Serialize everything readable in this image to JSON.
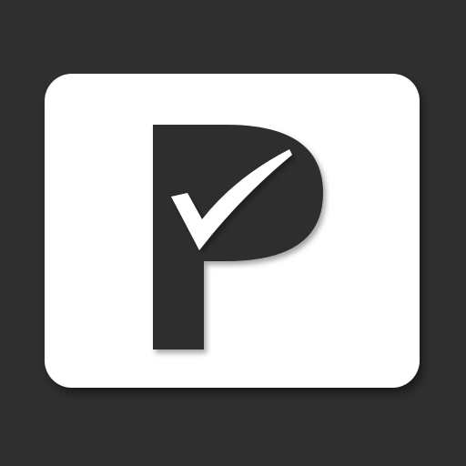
{
  "app_icon": {
    "background_color": "#2f2f2f",
    "card_color": "#ffffff",
    "glyph_color": "#2f2f2f",
    "check_color": "#ffffff",
    "letter": "P",
    "icon": "parking-check-icon"
  }
}
